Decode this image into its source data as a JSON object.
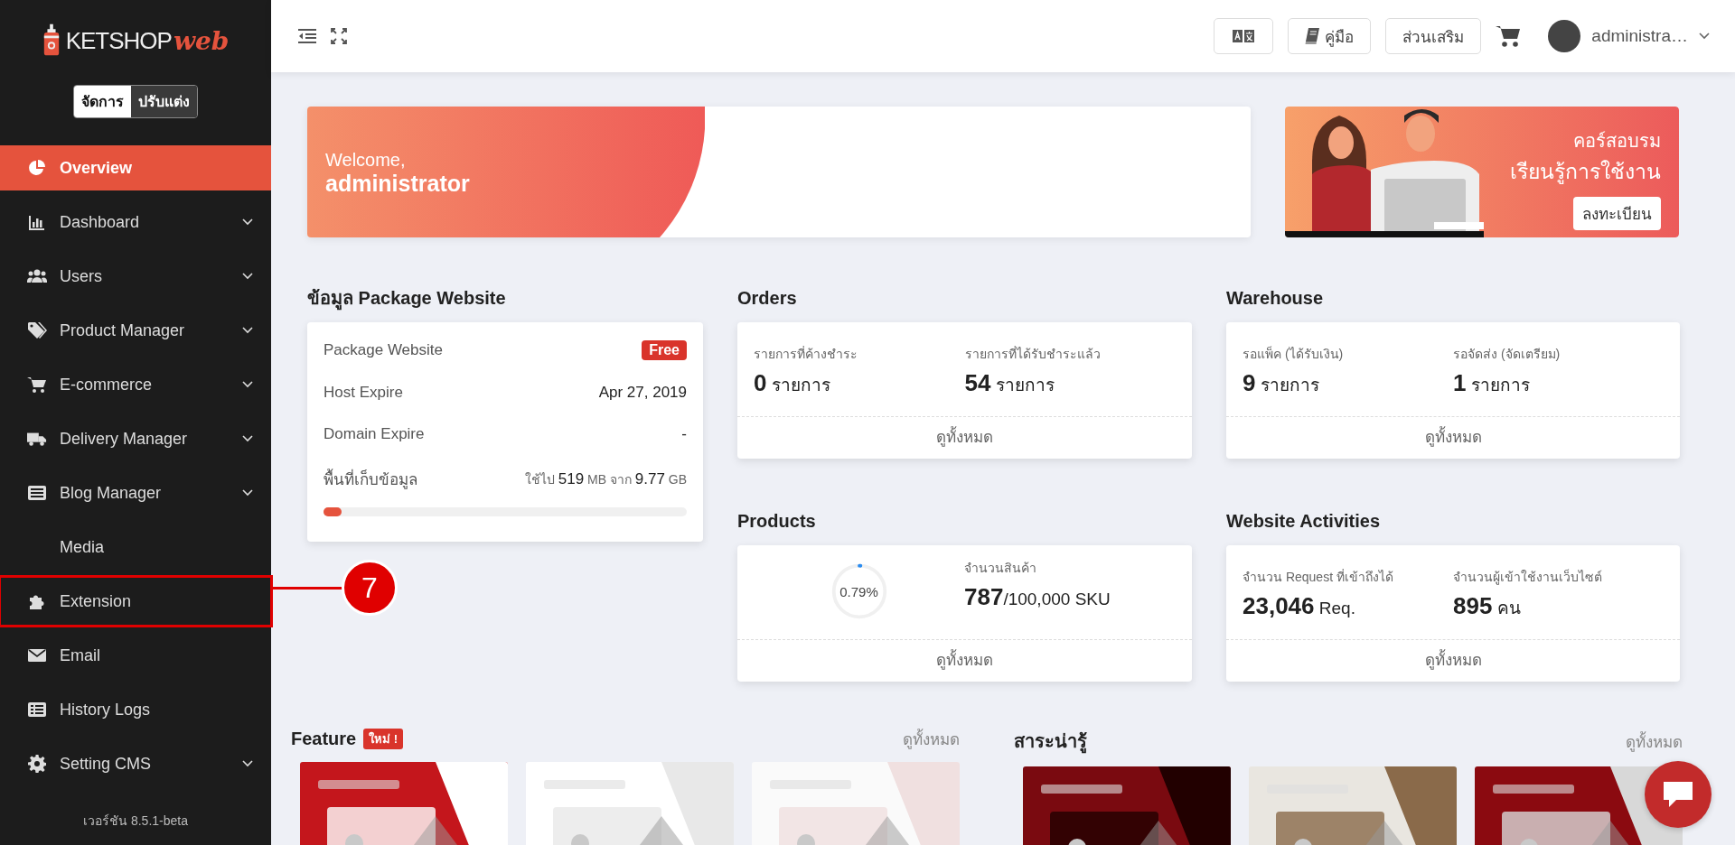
{
  "sidebar": {
    "logo": {
      "brand": "KETSHOP",
      "script": "web"
    },
    "mode_tabs": [
      {
        "label": "จัดการ",
        "selected": true
      },
      {
        "label": "ปรับแต่ง",
        "selected": false
      }
    ],
    "items": [
      {
        "label": "Overview",
        "selected": true,
        "expandable": false,
        "highlighted": false
      },
      {
        "label": "Dashboard",
        "selected": false,
        "expandable": true,
        "highlighted": false
      },
      {
        "label": "Users",
        "selected": false,
        "expandable": true,
        "highlighted": false
      },
      {
        "label": "Product Manager",
        "selected": false,
        "expandable": true,
        "highlighted": false
      },
      {
        "label": "E-commerce",
        "selected": false,
        "expandable": true,
        "highlighted": false
      },
      {
        "label": "Delivery Manager",
        "selected": false,
        "expandable": true,
        "highlighted": false
      },
      {
        "label": "Blog Manager",
        "selected": false,
        "expandable": true,
        "highlighted": false
      },
      {
        "label": "Media",
        "selected": false,
        "expandable": false,
        "highlighted": false
      },
      {
        "label": "Extension",
        "selected": false,
        "expandable": false,
        "highlighted": true
      },
      {
        "label": "Email",
        "selected": false,
        "expandable": false,
        "highlighted": false
      },
      {
        "label": "History Logs",
        "selected": false,
        "expandable": false,
        "highlighted": false
      },
      {
        "label": "Setting CMS",
        "selected": false,
        "expandable": true,
        "highlighted": false
      }
    ],
    "version": "เวอร์ชัน 8.5.1-beta"
  },
  "annotation": {
    "label": "7"
  },
  "topbar": {
    "manual_label": "คู่มือ",
    "addon_label": "ส่วนเสริม",
    "user_name": "administra…"
  },
  "welcome": {
    "greeting": "Welcome,",
    "name": "administrator"
  },
  "course": {
    "kind": "picture",
    "line1": "คอร์สอบรม",
    "line2": "เรียนรู้การใช้งาน",
    "button": "ลงทะเบียน"
  },
  "package": {
    "title": "ข้อมูล Package Website",
    "rows": [
      {
        "kind": "badge",
        "label": "Package Website",
        "value": "Free"
      },
      {
        "kind": "value",
        "label": "Host Expire",
        "value": "Apr 27, 2019"
      },
      {
        "kind": "value",
        "label": "Domain Expire",
        "value": "-"
      },
      {
        "kind": "storage",
        "label": "พื้นที่เก็บข้อมูล",
        "value": "ใช้ไป **519** MB จาก **9.77** GB",
        "level": 0.05
      }
    ]
  },
  "cards": [
    {
      "kind": "stats",
      "title": "Orders",
      "stats": [
        {
          "label": "รายการที่ค้างชำระ",
          "number": "0",
          "unit": "รายการ"
        },
        {
          "label": "รายการที่ได้รับชำระแล้ว",
          "number": "54",
          "unit": "รายการ"
        }
      ],
      "link": "ดูทั้งหมด"
    },
    {
      "kind": "stats",
      "title": "Warehouse",
      "stats": [
        {
          "label": "รอแพ็ค (ได้รับเงิน)",
          "number": "9",
          "unit": "รายการ"
        },
        {
          "label": "รอจัดส่ง (จัดเตรียม)",
          "number": "1",
          "unit": "รายการ"
        }
      ],
      "link": "ดูทั้งหมด"
    },
    {
      "kind": "progress",
      "title": "Products",
      "level": 0.0079,
      "percent": "0.79%",
      "stats": [
        {
          "label": "จำนวนสินค้า",
          "number": "787",
          "unit": "/100,000 SKU"
        }
      ],
      "link": "ดูทั้งหมด"
    },
    {
      "kind": "stats",
      "title": "Website Activities",
      "stats": [
        {
          "label": "จำนวน Request ที่เข้าถึงได้",
          "number": "23,046",
          "unit": "Req."
        },
        {
          "label": "จำนวนผู้เข้าใช้งานเว็บไซต์",
          "number": "895",
          "unit": "คน"
        }
      ],
      "link": "ดูทั้งหมด"
    }
  ],
  "sections": [
    {
      "title": "Feature",
      "badge": "ใหม่ !",
      "link": "ดูทั้งหมด"
    },
    {
      "title": "สาระน่ารู้",
      "link": "ดูทั้งหมด"
    }
  ]
}
